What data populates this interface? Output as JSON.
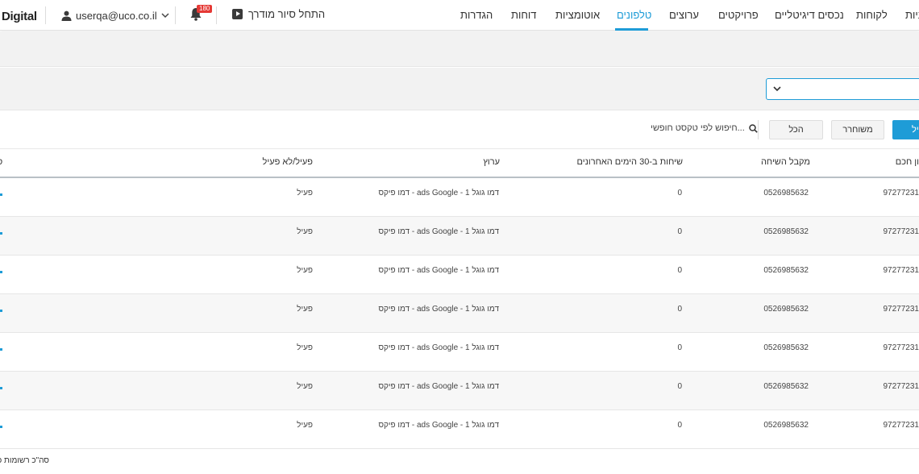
{
  "brand": "Digital",
  "user": {
    "email": "userqa@uco.co.il"
  },
  "notifications": {
    "count": "180"
  },
  "tour": {
    "label": "התחל סיור מודרך"
  },
  "nav": {
    "items": [
      "ניות",
      "לקוחות",
      "נכסים דיגיטליים",
      "פרויקטים",
      "ערוצים",
      "טלפונים",
      "אוטומציות",
      "דוחות",
      "הגדרות"
    ],
    "active": "טלפונים"
  },
  "filters": {
    "active_label": "יל",
    "released_label": "משוחרר",
    "all_label": "הכל",
    "search_placeholder": "חיפוש לפי טקסט חופשי..."
  },
  "table": {
    "headers": {
      "phone": "ון חכם",
      "receiver": "מקבל השיחה",
      "calls": "שיחות ב-30 הימים האחרונים",
      "channel": "ערוץ",
      "status": "פעיל/לא פעיל",
      "last": "ס"
    },
    "rows": [
      {
        "phone": "97277231",
        "receiver": "0526985632",
        "calls": "0",
        "channel": "דמו פיקס - ads Google - דמו גוגל 1",
        "status": "פעיל"
      },
      {
        "phone": "97277231",
        "receiver": "0526985632",
        "calls": "0",
        "channel": "דמו פיקס - ads Google - דמו גוגל 1",
        "status": "פעיל"
      },
      {
        "phone": "97277231",
        "receiver": "0526985632",
        "calls": "0",
        "channel": "דמו פיקס - ads Google - דמו גוגל 1",
        "status": "פעיל"
      },
      {
        "phone": "97277231",
        "receiver": "0526985632",
        "calls": "0",
        "channel": "דמו פיקס - ads Google - דמו גוגל 1",
        "status": "פעיל"
      },
      {
        "phone": "97277231",
        "receiver": "0526985632",
        "calls": "0",
        "channel": "דמו פיקס - ads Google - דמו גוגל 1",
        "status": "פעיל"
      },
      {
        "phone": "97277231",
        "receiver": "0526985632",
        "calls": "0",
        "channel": "דמו פיקס - ads Google - דמו גוגל 1",
        "status": "פעיל"
      },
      {
        "phone": "97277231",
        "receiver": "0526985632",
        "calls": "0",
        "channel": "דמו פיקס - ads Google - דמו גוגל 1",
        "status": "פעיל"
      }
    ]
  },
  "footer": {
    "total_label": "סה\"כ רשומות כ"
  },
  "colors": {
    "accent": "#1e9cd7",
    "badge": "#e53935"
  }
}
